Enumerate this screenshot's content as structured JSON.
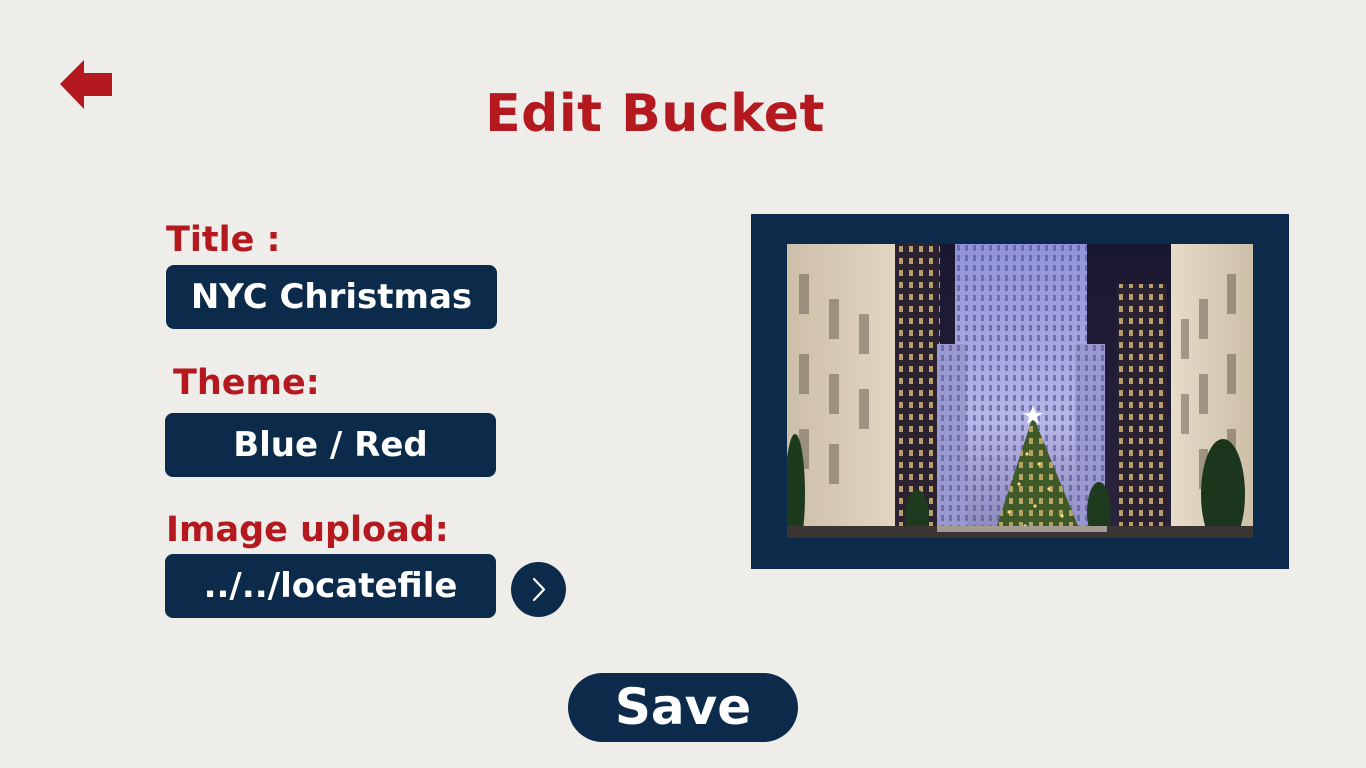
{
  "header": {
    "back_icon": "arrow-left-icon",
    "title": "Edit Bucket"
  },
  "form": {
    "title_label": "Title :",
    "title_value": "NYC Christmas",
    "theme_label": "Theme:",
    "theme_value": "Blue / Red",
    "image_label": "Image upload:",
    "image_path": "../../locatefile",
    "browse_icon": "chevron-right-icon"
  },
  "preview": {
    "image_subject": "rockefeller-christmas-tree-photo"
  },
  "actions": {
    "save_label": "Save"
  },
  "colors": {
    "background": "#efedea",
    "accent_red": "#b3191f",
    "navy": "#0c2a4a",
    "text_on_navy": "#ffffff"
  }
}
